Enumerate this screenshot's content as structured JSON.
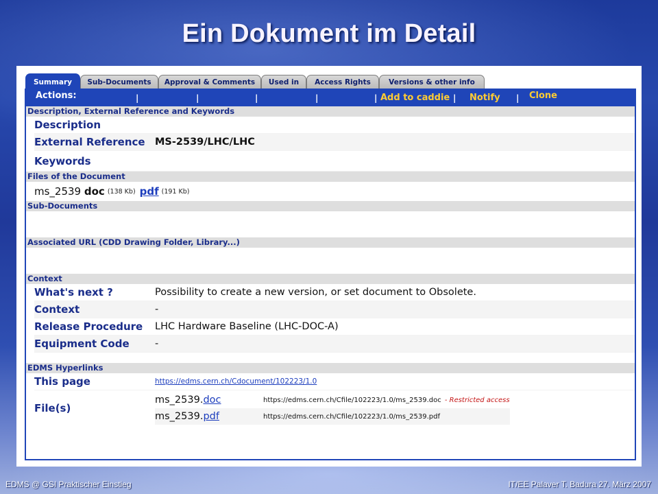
{
  "slide": {
    "title": "Ein Dokument im Detail",
    "footer_left": "EDMS @ GSI Praktischer Einstieg",
    "footer_right": "IT/EE Palaver T. Badura 27. März 2007"
  },
  "tabs": [
    {
      "label": "Summary",
      "active": true
    },
    {
      "label": "Sub-Documents"
    },
    {
      "label": "Approval & Comments"
    },
    {
      "label": "Used in"
    },
    {
      "label": "Access Rights"
    },
    {
      "label": "Versions & other info"
    }
  ],
  "actions": {
    "label": "Actions:",
    "separator": "|",
    "add_to_caddie": "Add to caddie",
    "notify": "Notify",
    "clone": "Clone"
  },
  "description_section": {
    "header": "Description, External Reference and Keywords",
    "description_label": "Description",
    "description_value": "",
    "external_reference_label": "External Reference",
    "external_reference_value": "MS-2539/LHC/LHC",
    "keywords_label": "Keywords",
    "keywords_value": ""
  },
  "files_section": {
    "header": "Files of the Document",
    "name": "ms_2539",
    "files": [
      {
        "format": "doc",
        "size": "(138 Kb)"
      },
      {
        "format": "pdf",
        "size": "(191 Kb)"
      }
    ]
  },
  "subdocuments_section": {
    "header": "Sub-Documents"
  },
  "associated_url_section": {
    "header": "Associated URL (CDD Drawing Folder, Library...)"
  },
  "context_section": {
    "header": "Context",
    "whats_next_label": "What's next ?",
    "whats_next_value": "Possibility to create a new version, or set document to Obsolete.",
    "context_label": "Context",
    "context_value": "-",
    "release_label": "Release Procedure",
    "release_value": "LHC Hardware Baseline (LHC-DOC-A)",
    "equipment_label": "Equipment Code",
    "equipment_value": "-"
  },
  "hyperlinks_section": {
    "header": "EDMS Hyperlinks",
    "this_page_label": "This page",
    "this_page_url": "https://edms.cern.ch/Cdocument/102223/1.0",
    "files_label": "File(s)",
    "files": [
      {
        "name": "ms_2539.",
        "ext": "doc",
        "url": "https://edms.cern.ch/Cfile/102223/1.0/ms_2539.doc",
        "note": "- Restricted access"
      },
      {
        "name": "ms_2539.",
        "ext": "pdf",
        "url": "https://edms.cern.ch/Cfile/102223/1.0/ms_2539.pdf",
        "note": ""
      }
    ]
  },
  "colors": {
    "tab_active": "#1f45b8",
    "action_link": "#ffcc33",
    "section_text": "#1a2d8a",
    "restricted": "#c41515"
  }
}
